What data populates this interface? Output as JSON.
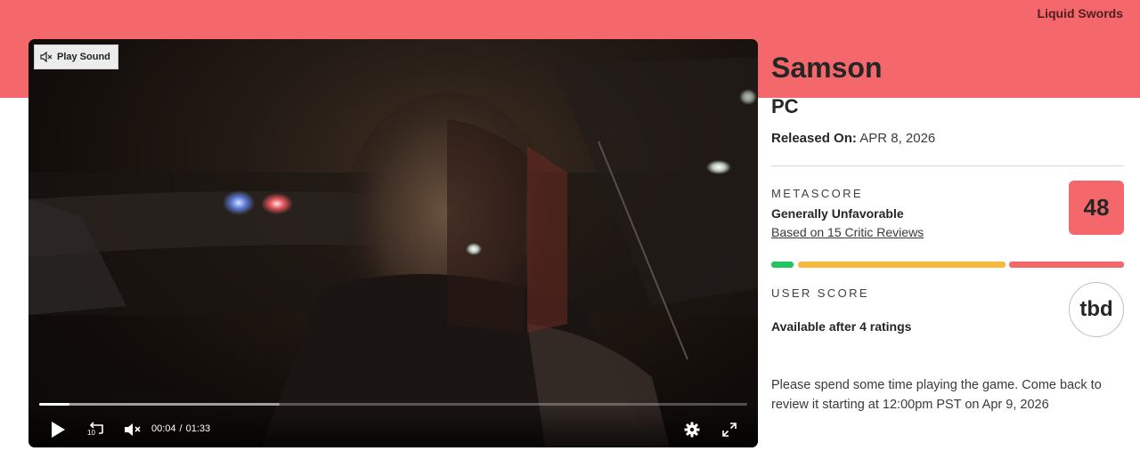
{
  "header": {
    "publisher": "Liquid Swords"
  },
  "video": {
    "play_sound_label": "Play Sound",
    "current_time": "00:04",
    "separator": "/",
    "duration": "01:33",
    "progress_fraction": 0.043,
    "buffered_fraction": 0.34,
    "replay_seconds_label": "10"
  },
  "game": {
    "title": "Samson",
    "platform": "PC",
    "released_label": "Released On:",
    "released_date": "APR 8, 2026"
  },
  "metascore": {
    "label": "METASCORE",
    "value": "48",
    "verdict": "Generally Unfavorable",
    "reviews_link": "Based on 15 Critic Reviews",
    "color": "#f4676b",
    "distribution": [
      {
        "sentiment": "positive",
        "color": "#22c55e"
      },
      {
        "sentiment": "mixed",
        "color": "#f5b93d"
      },
      {
        "sentiment": "negative",
        "color": "#f4676b"
      }
    ]
  },
  "userscore": {
    "label": "USER SCORE",
    "value": "tbd",
    "availability": "Available after 4 ratings"
  },
  "notice": "Please spend some time playing the game. Come back to review it starting at 12:00pm PST on Apr 9, 2026",
  "icons": [
    "speaker-muted-icon",
    "play-icon",
    "replay-10-icon",
    "volume-muted-icon",
    "gear-icon",
    "fullscreen-icon"
  ],
  "colors": {
    "band": "#f4676b",
    "text": "#262626"
  }
}
